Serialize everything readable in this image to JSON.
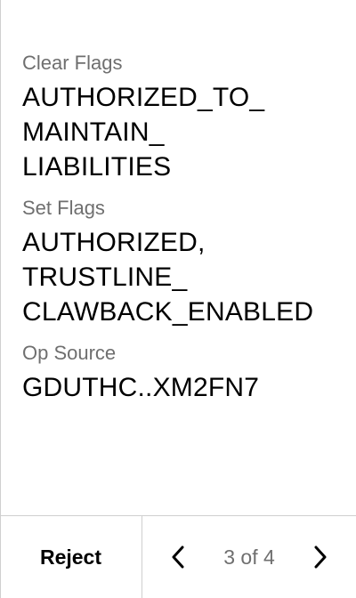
{
  "fields": [
    {
      "label": "Clear Flags",
      "value": "AUTHORIZED_TO_\nMAINTAIN_\nLIABILITIES"
    },
    {
      "label": "Set Flags",
      "value": "AUTHORIZED,\nTRUSTLINE_\nCLAWBACK_ENABLED"
    },
    {
      "label": "Op Source",
      "value": "GDUTHC..XM2FN7"
    }
  ],
  "footer": {
    "reject_label": "Reject",
    "pager_text": "3 of 4",
    "prev_icon": "chevron-left-icon",
    "next_icon": "chevron-right-icon"
  },
  "colors": {
    "label": "#6f6f6f",
    "value": "#000000",
    "divider": "#cfcfcf"
  }
}
